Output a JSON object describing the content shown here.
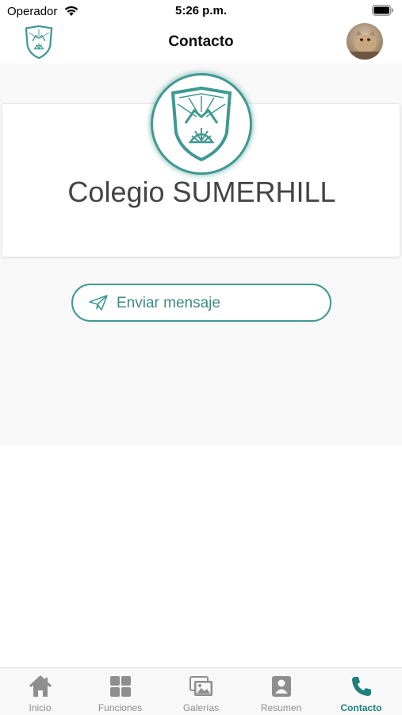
{
  "status_bar": {
    "carrier": "Operador",
    "time": "5:26 p.m.",
    "wifi_icon": "wifi-icon",
    "battery_icon": "battery-icon"
  },
  "header": {
    "title": "Contacto",
    "logo_icon": "school-shield-logo",
    "avatar_icon": "user-avatar-photo"
  },
  "school": {
    "name": "Colegio SUMERHILL",
    "logo_icon": "school-shield-logo"
  },
  "actions": {
    "send_message_label": "Enviar mensaje",
    "send_icon": "paper-plane-icon"
  },
  "tabs": [
    {
      "label": "Inicio",
      "icon": "home-icon",
      "active": false
    },
    {
      "label": "Funciones",
      "icon": "grid-icon",
      "active": false
    },
    {
      "label": "Galerías",
      "icon": "gallery-icon",
      "active": false
    },
    {
      "label": "Resumen",
      "icon": "contact-card-icon",
      "active": false
    },
    {
      "label": "Contacto",
      "icon": "phone-icon",
      "active": true
    }
  ],
  "colors": {
    "accent": "#3f9993",
    "accent_text": "#1f7f7a",
    "inactive_tab": "#8e8e8e",
    "content_background": "#f8f8f8"
  }
}
